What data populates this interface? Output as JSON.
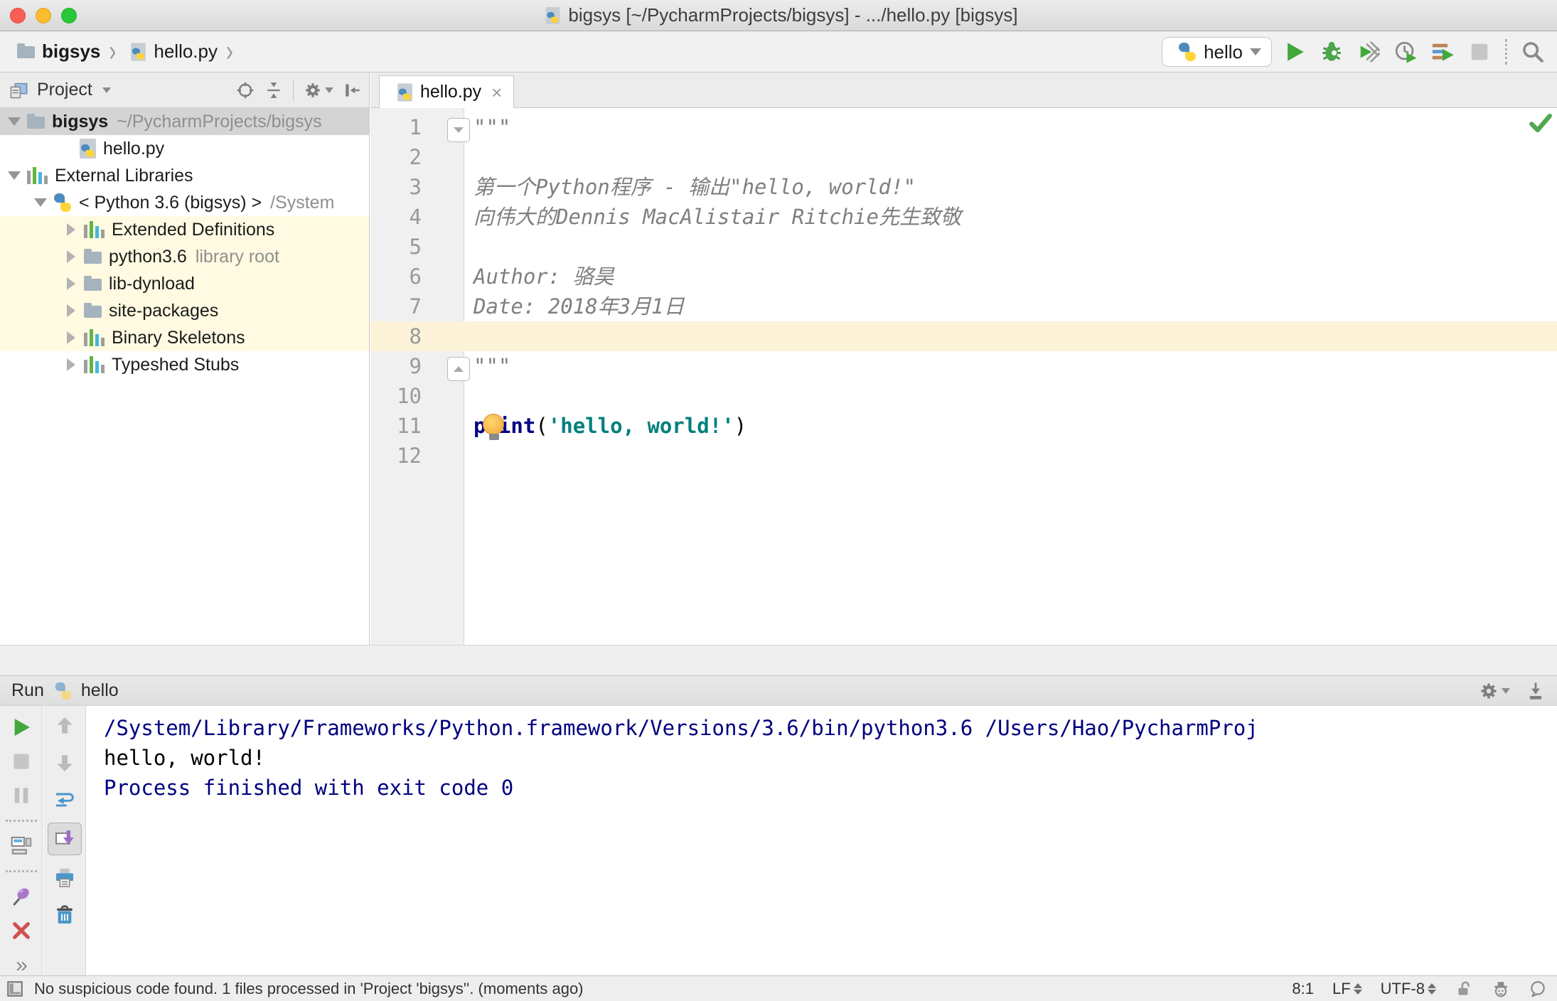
{
  "window": {
    "title": "bigsys [~/PycharmProjects/bigsys] - .../hello.py [bigsys]"
  },
  "toolbar": {
    "breadcrumbs": [
      {
        "label": "bigsys"
      },
      {
        "label": "hello.py"
      }
    ],
    "run_config": {
      "label": "hello"
    }
  },
  "project": {
    "header": {
      "title": "Project"
    },
    "tree": [
      {
        "label": "bigsys",
        "secondary": "~/PycharmProjects/bigsys",
        "icon": "folder-icon",
        "expander": "expanded",
        "selected": true
      },
      {
        "label": "hello.py",
        "icon": "python-file-icon"
      },
      {
        "label": "External Libraries",
        "icon": "library-icon",
        "expander": "expanded"
      },
      {
        "label": "< Python 3.6 (bigsys) >",
        "secondary": "/System",
        "icon": "python-logo-icon",
        "expander": "expanded"
      },
      {
        "label": "Extended Definitions",
        "icon": "library-icon",
        "expander": "collapsed",
        "highlighted": true
      },
      {
        "label": "python3.6",
        "secondary": "library root",
        "icon": "folder-icon",
        "expander": "collapsed",
        "highlighted": true
      },
      {
        "label": "lib-dynload",
        "icon": "folder-icon",
        "expander": "collapsed",
        "highlighted": true
      },
      {
        "label": "site-packages",
        "icon": "folder-icon",
        "expander": "collapsed",
        "highlighted": true
      },
      {
        "label": "Binary Skeletons",
        "icon": "library-icon",
        "expander": "collapsed",
        "highlighted": true
      },
      {
        "label": "Typeshed Stubs",
        "icon": "library-icon",
        "expander": "collapsed"
      }
    ]
  },
  "editor": {
    "tab": {
      "label": "hello.py",
      "close_glyph": "×"
    },
    "lines": [
      {
        "num": "1",
        "text": "\"\"\"",
        "style": "doc"
      },
      {
        "num": "2",
        "text": ""
      },
      {
        "num": "3",
        "text": "第一个Python程序 - 输出\"hello, world!\"",
        "style": "doc"
      },
      {
        "num": "4",
        "text": "向伟大的Dennis MacAlistair Ritchie先生致敬",
        "style": "doc"
      },
      {
        "num": "5",
        "text": ""
      },
      {
        "num": "6",
        "text": "Author: 骆昊",
        "style": "doc"
      },
      {
        "num": "7",
        "text": "Date: 2018年3月1日",
        "style": "doc"
      },
      {
        "num": "8",
        "text": ""
      },
      {
        "num": "9",
        "text": "\"\"\"",
        "style": "doc"
      },
      {
        "num": "10",
        "text": ""
      },
      {
        "num": "11",
        "segments": [
          {
            "t": "print",
            "c": "keyword"
          },
          {
            "t": "(",
            "c": "plain"
          },
          {
            "t": "'hello, world!'",
            "c": "string"
          },
          {
            "t": ")",
            "c": "plain"
          }
        ]
      },
      {
        "num": "12",
        "text": ""
      }
    ]
  },
  "run_panel": {
    "tab_label": "Run",
    "config_label": "hello",
    "more_glyph": "»",
    "output": [
      {
        "text": "/System/Library/Frameworks/Python.framework/Versions/3.6/bin/python3.6 /Users/Hao/PycharmProj",
        "style": "stdinfo"
      },
      {
        "text": "hello, world!",
        "style": "stdout"
      },
      {
        "text": "",
        "style": "stdout"
      },
      {
        "text": "Process finished with exit code 0",
        "style": "stdinfo"
      }
    ]
  },
  "status_bar": {
    "message": "No suspicious code found. 1 files processed in 'Project 'bigsys''. (moments ago)",
    "caret_position": "8:1",
    "line_separator": "LF",
    "encoding": "UTF-8"
  },
  "colors": {
    "run_green": "#42A83C",
    "keyword_navy": "#000080",
    "string_teal": "#00807B",
    "caret_line_bg": "#FCF3D9",
    "library_row_bg": "#FFFAE1",
    "selected_row_bg": "#D4D4D4",
    "python_blue": "#4B8BBE",
    "python_yellow": "#FFD43B"
  }
}
